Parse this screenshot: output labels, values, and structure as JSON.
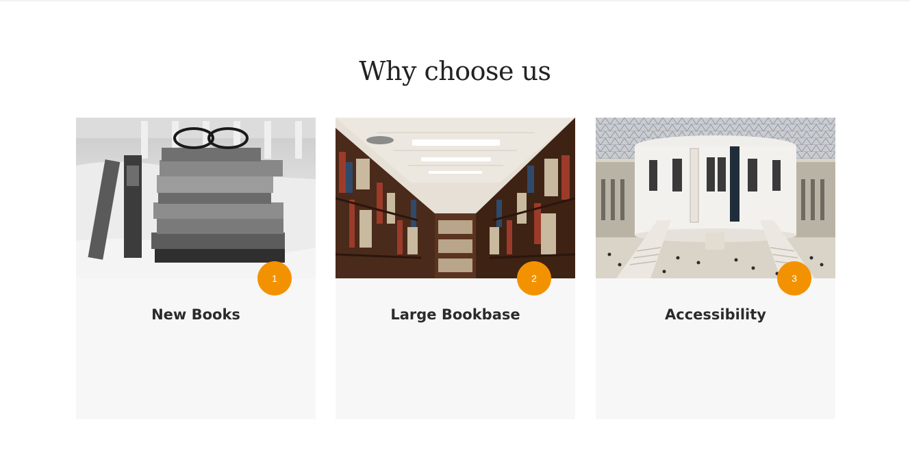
{
  "section": {
    "title": "Why choose us"
  },
  "cards": [
    {
      "number": "1",
      "title": "New Books",
      "image": "stack-of-books-with-glasses-photo"
    },
    {
      "number": "2",
      "title": "Large Bookbase",
      "image": "library-bookshelf-aisle-photo"
    },
    {
      "number": "3",
      "title": "Accessibility",
      "image": "museum-great-court-photo"
    }
  ],
  "colors": {
    "accent": "#f39200",
    "card_bg": "#f7f7f7",
    "heading": "#222222"
  }
}
